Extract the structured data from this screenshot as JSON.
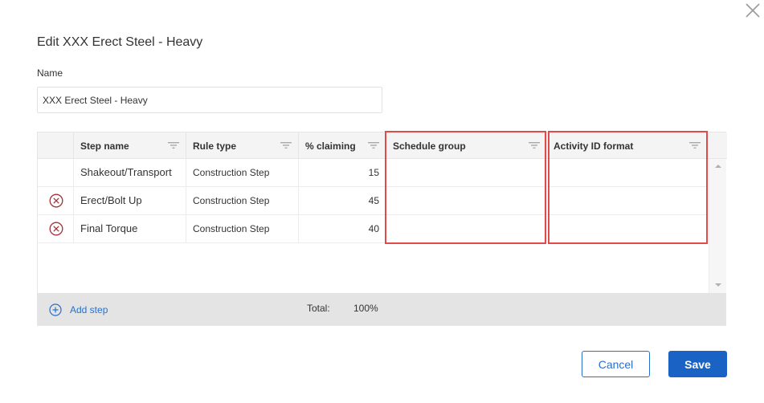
{
  "dialog": {
    "title": "Edit XXX Erect Steel - Heavy",
    "close_icon": "close-icon"
  },
  "name_field": {
    "label": "Name",
    "value": "XXX Erect Steel - Heavy"
  },
  "grid": {
    "columns": [
      {
        "label": "Step name",
        "filter_icon": "filter-icon"
      },
      {
        "label": "Rule type",
        "filter_icon": "filter-icon"
      },
      {
        "label": "% claiming",
        "filter_icon": "filter-icon"
      },
      {
        "label": "Schedule group",
        "filter_icon": "filter-icon"
      },
      {
        "label": "Activity ID format",
        "filter_icon": "filter-icon"
      }
    ],
    "rows": [
      {
        "deletable": false,
        "step_name": "Shakeout/Transport",
        "rule_type": "Construction Step",
        "percent_claiming": "15",
        "schedule_group": "",
        "activity_id_format": ""
      },
      {
        "deletable": true,
        "step_name": "Erect/Bolt Up",
        "rule_type": "Construction Step",
        "percent_claiming": "45",
        "schedule_group": "",
        "activity_id_format": ""
      },
      {
        "deletable": true,
        "step_name": "Final Torque",
        "rule_type": "Construction Step",
        "percent_claiming": "40",
        "schedule_group": "",
        "activity_id_format": ""
      }
    ],
    "footer": {
      "add_step_label": "Add step",
      "add_icon": "plus-circle-icon",
      "total_label": "Total:",
      "total_value": "100%"
    }
  },
  "actions": {
    "cancel_label": "Cancel",
    "save_label": "Save"
  },
  "colors": {
    "accent": "#1a63c4",
    "link": "#2a6fc9",
    "delete_icon": "#a3323a",
    "highlight": "#e04a4a"
  }
}
